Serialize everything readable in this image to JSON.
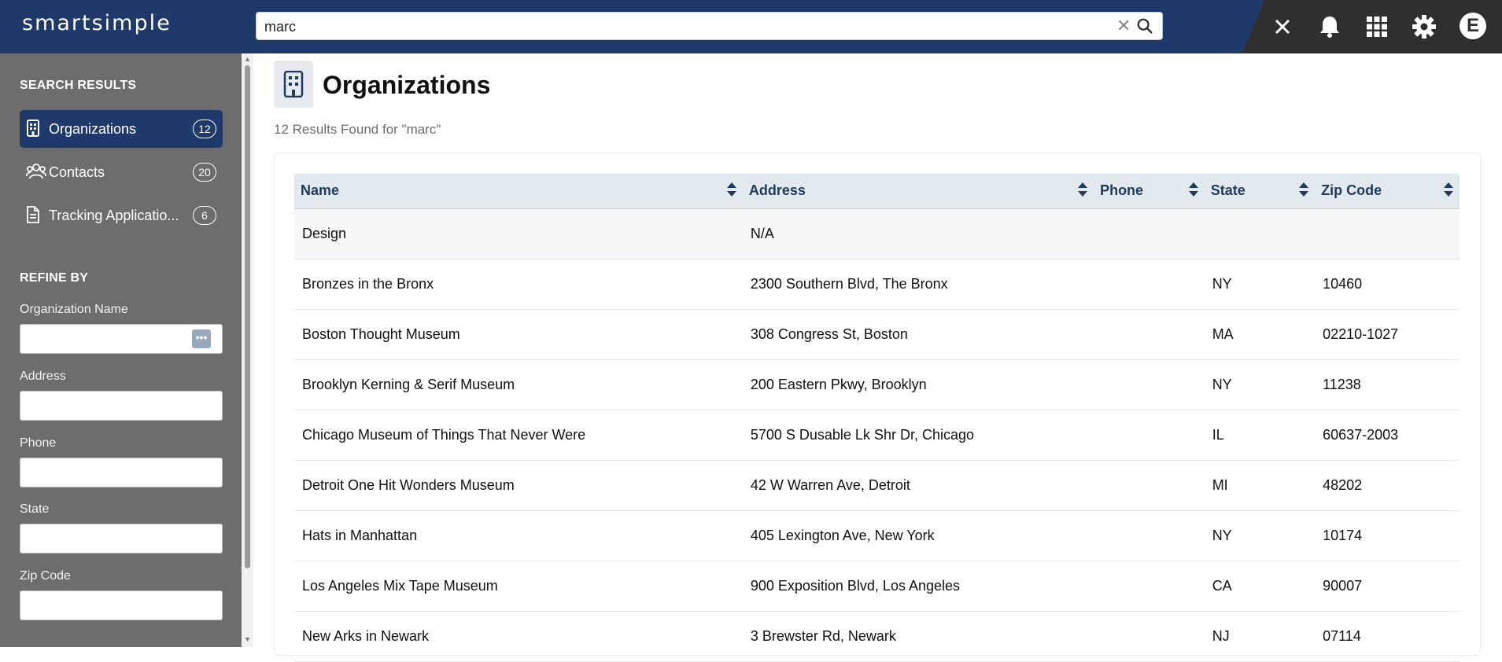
{
  "app": {
    "logo": "smartsimple"
  },
  "search": {
    "value": "marc"
  },
  "topbar": {
    "user_initial": "E"
  },
  "sidebar": {
    "search_results_heading": "SEARCH RESULTS",
    "items": [
      {
        "label": "Organizations",
        "count": "12",
        "active": true
      },
      {
        "label": "Contacts",
        "count": "20",
        "active": false
      },
      {
        "label": "Tracking Applicatio...",
        "count": "6",
        "active": false
      }
    ],
    "refine_heading": "REFINE BY",
    "fields": [
      {
        "label": "Organization Name",
        "value": ""
      },
      {
        "label": "Address",
        "value": ""
      },
      {
        "label": "Phone",
        "value": ""
      },
      {
        "label": "State",
        "value": ""
      },
      {
        "label": "Zip Code",
        "value": ""
      }
    ]
  },
  "main": {
    "title": "Organizations",
    "results_text": "12 Results Found for \"marc\"",
    "columns": [
      "Name",
      "Address",
      "Phone",
      "State",
      "Zip Code"
    ],
    "rows": [
      [
        "Design",
        "N/A",
        "",
        "",
        ""
      ],
      [
        "Bronzes in the Bronx",
        "2300 Southern Blvd, The Bronx",
        "",
        "NY",
        "10460"
      ],
      [
        "Boston Thought Museum",
        "308 Congress St, Boston",
        "",
        "MA",
        "02210-1027"
      ],
      [
        "Brooklyn Kerning & Serif Museum",
        "200 Eastern Pkwy, Brooklyn",
        "",
        "NY",
        "11238"
      ],
      [
        "Chicago Museum of Things That Never Were",
        "5700 S Dusable Lk Shr Dr, Chicago",
        "",
        "IL",
        "60637-2003"
      ],
      [
        "Detroit One Hit Wonders Museum",
        "42 W Warren Ave, Detroit",
        "",
        "MI",
        "48202"
      ],
      [
        "Hats in Manhattan",
        "405 Lexington Ave, New York",
        "",
        "NY",
        "10174"
      ],
      [
        "Los Angeles Mix Tape Museum",
        "900 Exposition Blvd, Los Angeles",
        "",
        "CA",
        "90007"
      ],
      [
        "New Arks in Newark",
        "3 Brewster Rd, Newark",
        "",
        "NJ",
        "07114"
      ]
    ]
  },
  "colors": {
    "nav_blue": "#1f3a6a",
    "sidebar_gray": "#6d6d6d",
    "header_row": "#e3eaef"
  }
}
